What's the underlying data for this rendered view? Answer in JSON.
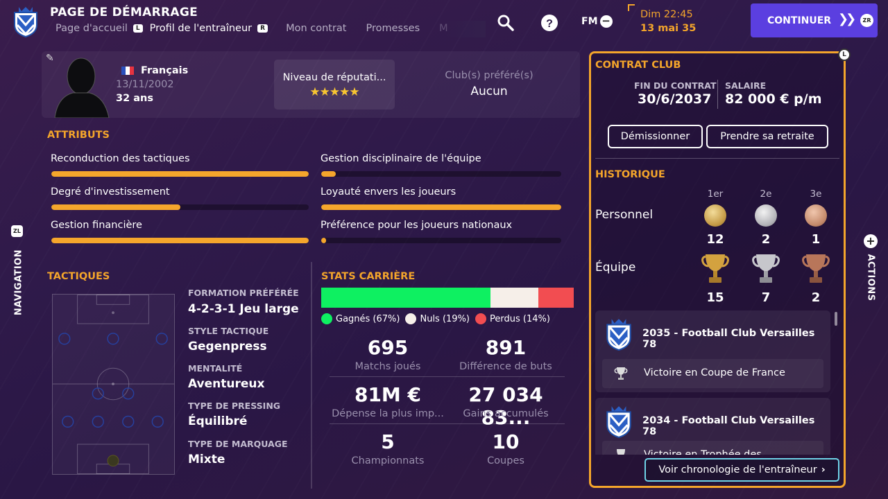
{
  "header": {
    "title": "PAGE DE DÉMARRAGE",
    "tabs": [
      {
        "label": "Page d'accueil",
        "key_before": "L"
      },
      {
        "label": "Profil de l'entraîneur",
        "key_after": "R"
      },
      {
        "label": "Mon contrat"
      },
      {
        "label": "Promesses"
      },
      {
        "label": "M"
      }
    ],
    "fm_label": "FM",
    "date_time": "Dim 22:45",
    "date_day": "13 mai 35",
    "continue_label": "CONTINUER",
    "continue_key": "ZR",
    "accent": "#f4a52b",
    "continue_color": "#5b3fe0"
  },
  "side": {
    "nav_key": "ZL",
    "nav_label": "NAVIGATION",
    "actions_label": "ACTIONS"
  },
  "profile": {
    "nationality": "Français",
    "dob": "13/11/2002",
    "age": "32 ans",
    "reputation_label": "Niveau de réputati...",
    "reputation_stars": "★★★★★",
    "favorite_clubs_label": "Club(s) préféré(s)",
    "favorite_clubs_value": "Aucun"
  },
  "attributes": {
    "title": "ATTRIBUTS",
    "items": [
      {
        "label": "Reconduction des tactiques",
        "level": 1.0
      },
      {
        "label": "Gestion disciplinaire de l'équipe",
        "level": 0.06
      },
      {
        "label": "Degré d'investissement",
        "level": 0.5
      },
      {
        "label": "Loyauté envers les joueurs",
        "level": 1.0
      },
      {
        "label": "Gestion financière",
        "level": 1.0
      },
      {
        "label": "Préférence pour les joueurs nationaux",
        "level": 0.02
      }
    ]
  },
  "tactics": {
    "title": "TACTIQUES",
    "fields": [
      {
        "label": "FORMATION PRÉFÉRÉE",
        "value": "4-2-3-1 Jeu large"
      },
      {
        "label": "STYLE TACTIQUE",
        "value": "Gegenpress"
      },
      {
        "label": "MENTALITÉ",
        "value": "Aventureux"
      },
      {
        "label": "TYPE DE PRESSING",
        "value": "Équilibré"
      },
      {
        "label": "TYPE DE MARQUAGE",
        "value": "Mixte"
      }
    ]
  },
  "stats": {
    "title": "STATS CARRIÈRE",
    "won_pct": 67,
    "draw_pct": 19,
    "lost_pct": 14,
    "won_label": "Gagnés (67%)",
    "draw_label": "Nuls (19%)",
    "lost_label": "Perdus (14%)",
    "won_color": "#0ef061",
    "draw_color": "#f6efe9",
    "lost_color": "#f24d51",
    "items": [
      {
        "value": "695",
        "label": "Matchs joués"
      },
      {
        "value": "891",
        "label": "Différence de buts"
      },
      {
        "value": "81M €",
        "label": "Dépense la plus imp..."
      },
      {
        "value": "27 034 83...",
        "label": "Gains accumulés"
      },
      {
        "value": "5",
        "label": "Championnats"
      },
      {
        "value": "10",
        "label": "Coupes"
      }
    ]
  },
  "contract": {
    "title": "CONTRAT CLUB",
    "end_label": "FIN DU CONTRAT",
    "end_value": "30/6/2037",
    "salary_label": "SALAIRE",
    "salary_value": "82 000 € p/m",
    "resign_label": "Démissionner",
    "retire_label": "Prendre sa retraite"
  },
  "history": {
    "title": "HISTORIQUE",
    "cols": [
      "1er",
      "2e",
      "3e"
    ],
    "personal_label": "Personnel",
    "personal": [
      "12",
      "2",
      "1"
    ],
    "team_label": "Équipe",
    "team": [
      "15",
      "7",
      "2"
    ],
    "entries": [
      {
        "title": "2035 - Football Club Versailles 78",
        "sub": "Victoire en Coupe de France"
      },
      {
        "title": "2034 - Football Club Versailles 78",
        "sub": "Victoire en Trophée des"
      }
    ],
    "chronology_label": "Voir chronologie de l'entraîneur",
    "clock_key": "L"
  }
}
